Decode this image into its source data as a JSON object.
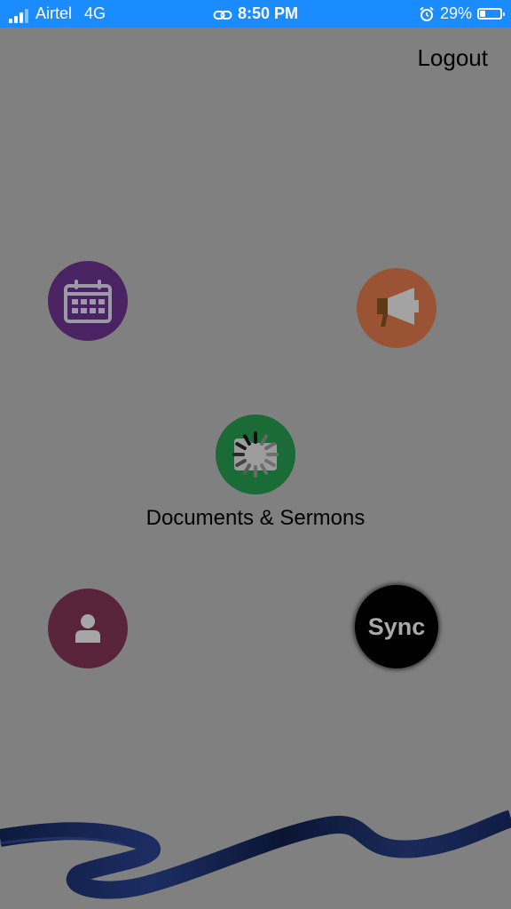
{
  "status_bar": {
    "carrier": "Airtel",
    "network": "4G",
    "time": "8:50 PM",
    "battery": "29%",
    "battery_level": 0.29
  },
  "header": {
    "logout_label": "Logout"
  },
  "menu": {
    "documents_label": "Documents & Sermons",
    "sync_label": "Sync"
  },
  "colors": {
    "status_bar": "#1a8cff",
    "overlay": "#808080",
    "calendar": "#4a2362",
    "announcements": "#9a5334",
    "documents": "#1b6b37",
    "profile": "#5a2438",
    "sync": "#000000"
  },
  "icons": [
    "signal-icon",
    "link-icon",
    "alarm-icon",
    "battery-icon",
    "calendar-icon",
    "megaphone-icon",
    "folder-icon",
    "loading-spinner",
    "user-icon",
    "ribbon-decoration"
  ]
}
